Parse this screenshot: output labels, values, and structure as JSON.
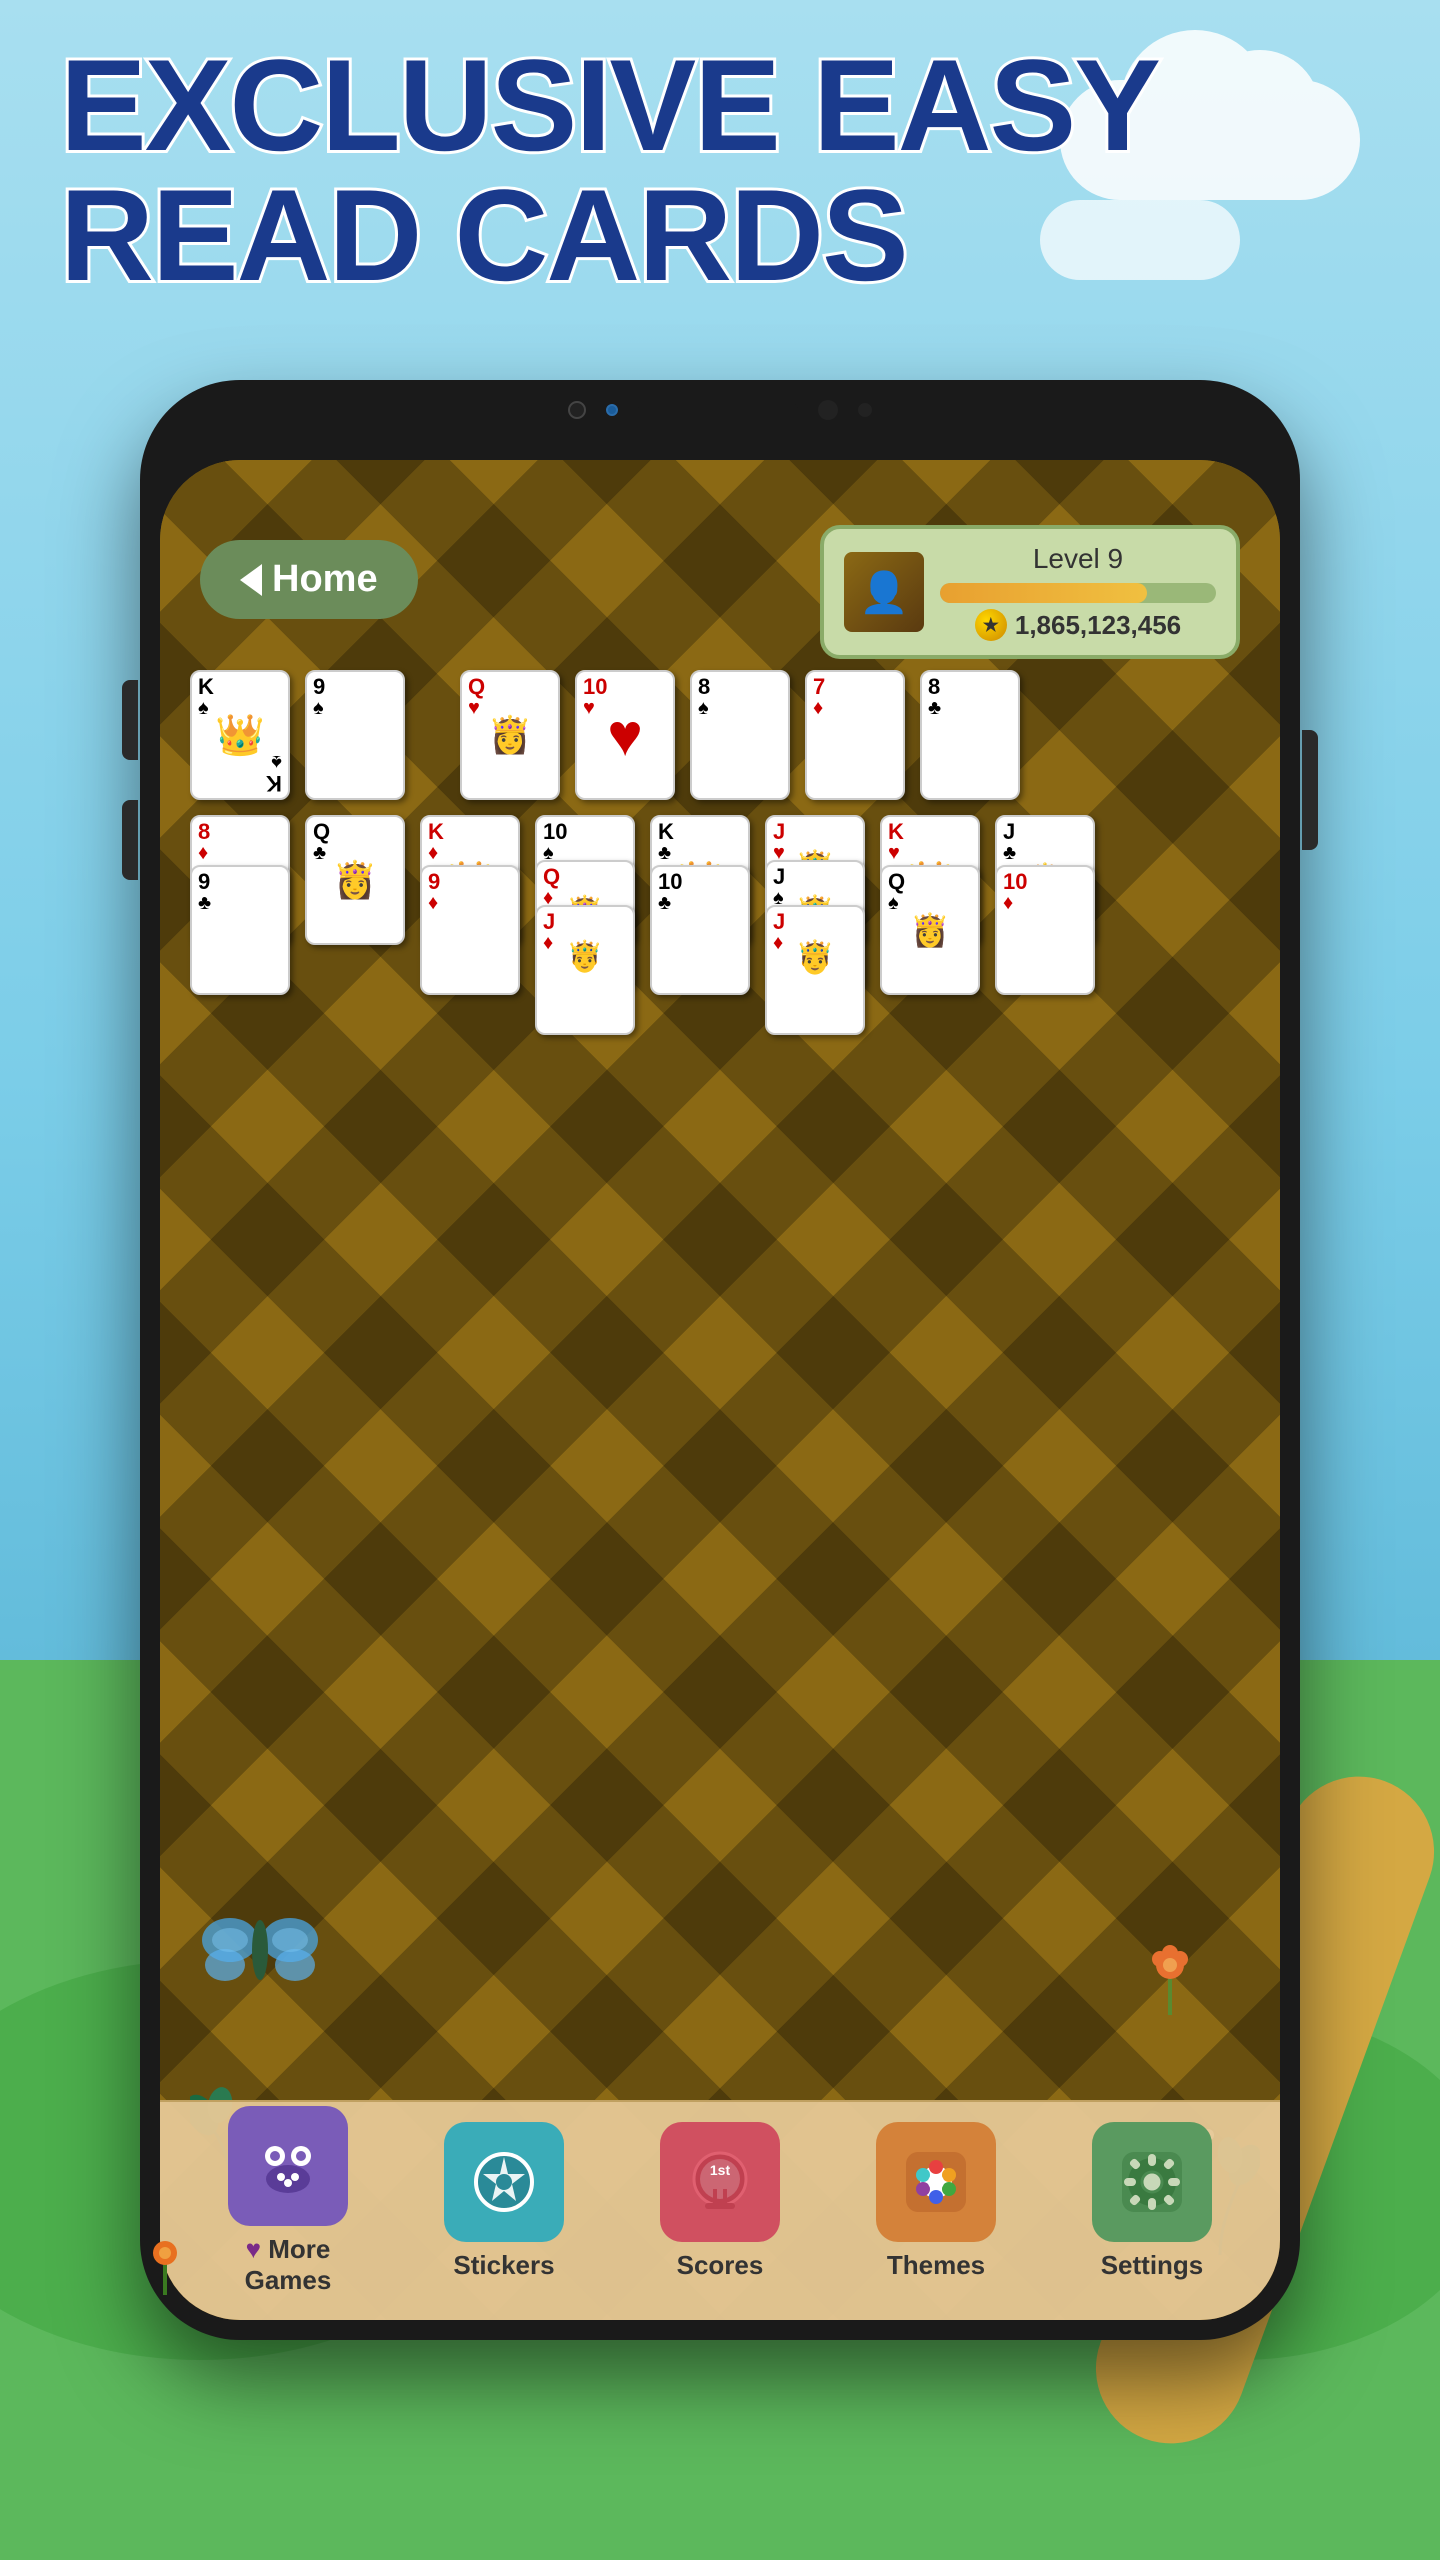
{
  "title": "EXCLUSIVE EASY READ CARDS",
  "title_line1": "EXCLUSIVE EASY",
  "title_line2": "READ CARDS",
  "game": {
    "home_button": "Home",
    "level": {
      "label": "Level 9",
      "progress": 75,
      "coins": "1,865,123,456"
    },
    "cards_row1": [
      {
        "rank": "K",
        "suit": "♠",
        "color": "black",
        "face": true,
        "type": "king"
      },
      {
        "rank": "9",
        "suit": "♠",
        "color": "black"
      },
      {
        "rank": "Q",
        "suit": "♥",
        "color": "red",
        "face": true,
        "type": "queen"
      },
      {
        "rank": "10",
        "suit": "♥",
        "color": "red",
        "big_heart": true
      },
      {
        "rank": "8",
        "suit": "♠",
        "color": "black"
      },
      {
        "rank": "7",
        "suit": "♦",
        "color": "red"
      },
      {
        "rank": "8",
        "suit": "♣",
        "color": "black"
      }
    ],
    "cards_row2": [
      {
        "rank": "8",
        "suit": "♦",
        "color": "red",
        "over": {
          "rank": "9",
          "suit": "♣",
          "color": "black"
        }
      },
      {
        "rank": "Q",
        "suit": "♣",
        "color": "black",
        "face": true
      },
      {
        "rank": "K",
        "suit": "♦",
        "color": "red",
        "face": true,
        "over": {
          "rank": "9",
          "suit": "♦",
          "color": "red"
        }
      },
      {
        "rank": "10",
        "suit": "♠",
        "color": "black",
        "over": {
          "rank": "Q",
          "suit": "♦",
          "color": "red"
        },
        "over2": {
          "rank": "J",
          "suit": "♦",
          "color": "red"
        }
      },
      {
        "rank": "K",
        "suit": "♣",
        "color": "black",
        "face": true,
        "over": {
          "rank": "10",
          "suit": "♣",
          "color": "black"
        }
      },
      {
        "rank": "J",
        "suit": "♥",
        "color": "red",
        "face": true,
        "over": {
          "rank": "J",
          "suit": "♠",
          "color": "black"
        },
        "over2": {
          "rank": "J",
          "suit": "♦",
          "color": "red"
        }
      },
      {
        "rank": "K",
        "suit": "♥",
        "color": "red",
        "face": true,
        "over": {
          "rank": "Q",
          "suit": "♠",
          "color": "black"
        }
      },
      {
        "rank": "J",
        "suit": "♣",
        "color": "black",
        "over": {
          "rank": "10",
          "suit": "♦",
          "color": "red"
        }
      }
    ]
  },
  "bottom_nav": {
    "items": [
      {
        "id": "more-games",
        "label": "More\nGames",
        "icon": "👾",
        "color": "#7a5cb8"
      },
      {
        "id": "stickers",
        "label": "Stickers",
        "icon": "⭐",
        "color": "#3aacb8"
      },
      {
        "id": "scores",
        "label": "Scores",
        "icon": "🏆",
        "color": "#d05060"
      },
      {
        "id": "themes",
        "label": "Themes",
        "icon": "🎨",
        "color": "#d4823a"
      },
      {
        "id": "settings",
        "label": "Settings",
        "icon": "⚙️",
        "color": "#5a9a60"
      }
    ]
  }
}
